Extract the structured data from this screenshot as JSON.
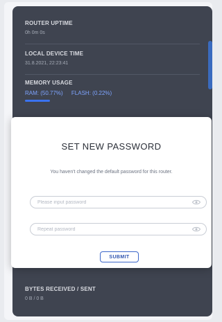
{
  "router_uptime": {
    "label": "ROUTER UPTIME",
    "value": "0h 0m 0s"
  },
  "local_device_time": {
    "label": "LOCAL DEVICE TIME",
    "value": "31.8.2021, 22:23:41"
  },
  "memory_usage": {
    "label": "MEMORY USAGE",
    "ram": "RAM: (50.77%)",
    "flash": "FLASH: (0.22%)"
  },
  "bytes": {
    "label": "BYTES RECEIVED / SENT",
    "value": "0 B / 0 B"
  },
  "modal": {
    "title": "SET NEW PASSWORD",
    "message": "You haven't changed the default password for this router.",
    "password_placeholder": "Please input password",
    "repeat_placeholder": "Repeat password",
    "submit_label": "SUBMIT"
  },
  "colors": {
    "accent": "#3a73f0",
    "panel": "#3f4450",
    "button_border": "#3b66c9"
  },
  "icons": {
    "eye": "eye-icon"
  }
}
